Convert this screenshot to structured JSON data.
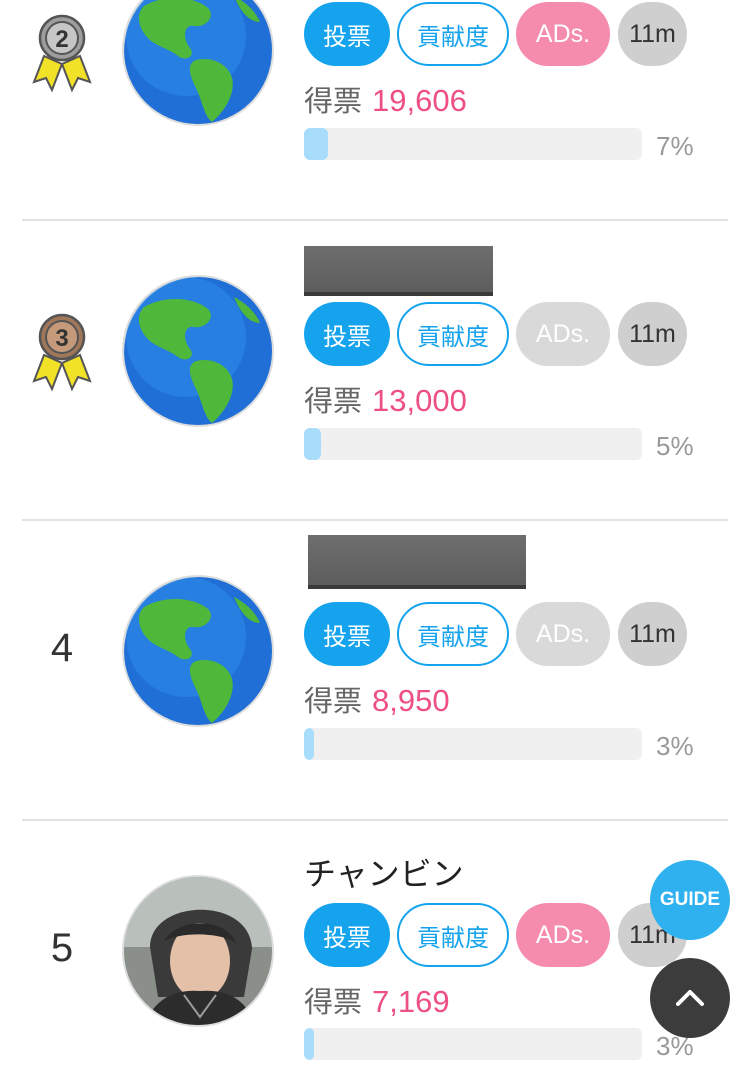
{
  "buttons": {
    "vote": "投票",
    "contribution": "貢献度",
    "ads": "ADs.",
    "time": "11m"
  },
  "votes_label": "得票",
  "items": [
    {
      "rank": "2",
      "rank_display": "medal",
      "medal_color": "#9e9e9e",
      "name": "",
      "name_redacted": false,
      "avatar": "earth-icon",
      "votes": "19,606",
      "percent": "7%",
      "bar_fraction": 0.07,
      "ads_active": true
    },
    {
      "rank": "3",
      "rank_display": "medal",
      "medal_color": "#a1775a",
      "name": "",
      "name_redacted": true,
      "avatar": "earth-icon",
      "votes": "13,000",
      "percent": "5%",
      "bar_fraction": 0.05,
      "ads_active": false
    },
    {
      "rank": "4",
      "rank_display": "number",
      "name": "",
      "name_redacted": true,
      "avatar": "earth-icon",
      "votes": "8,950",
      "percent": "3%",
      "bar_fraction": 0.03,
      "ads_active": false
    },
    {
      "rank": "5",
      "rank_display": "number",
      "name": "チャンビン",
      "name_redacted": false,
      "avatar": "photo",
      "votes": "7,169",
      "percent": "3%",
      "bar_fraction": 0.03,
      "ads_active": true
    }
  ],
  "guide_button": "GUIDE",
  "scroll_top_icon": "chevron-up-icon",
  "colors": {
    "accent": "#16a3ee",
    "votes": "#ee4f86",
    "ads_active": "#f58cad",
    "ads_inactive": "#d9d9d9"
  }
}
